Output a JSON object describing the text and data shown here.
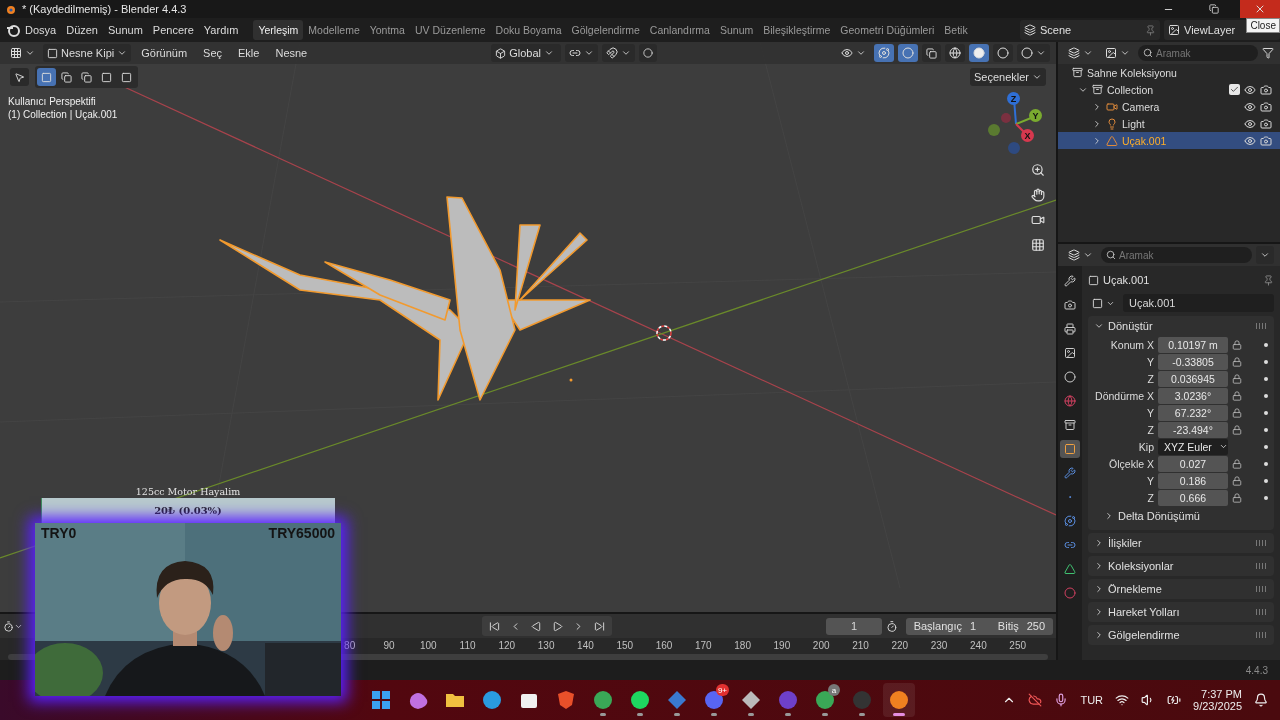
{
  "window": {
    "title": "* (Kaydedilmemiş) - Blender 4.4.3",
    "tooltip": "Close"
  },
  "menu": [
    "Dosya",
    "Düzen",
    "Sunum",
    "Pencere",
    "Yardım"
  ],
  "workspaces": [
    {
      "label": "Yerleşim",
      "selected": true
    },
    {
      "label": "Modelleme",
      "selected": false
    },
    {
      "label": "Yontma",
      "selected": false
    },
    {
      "label": "UV Düzenleme",
      "selected": false
    },
    {
      "label": "Doku Boyama",
      "selected": false
    },
    {
      "label": "Gölgelendirme",
      "selected": false
    },
    {
      "label": "Canlandırma",
      "selected": false
    },
    {
      "label": "Sunum",
      "selected": false
    },
    {
      "label": "Bileşikleştirme",
      "selected": false
    },
    {
      "label": "Geometri Düğümleri",
      "selected": false
    },
    {
      "label": "Betik",
      "selected": false
    }
  ],
  "scene": "Scene",
  "view_layer": "ViewLayer",
  "viewport": {
    "mode": "Nesne Kipi",
    "menus": [
      "Görünüm",
      "Seç",
      "Ekle",
      "Nesne"
    ],
    "orientation": "Global",
    "options": "Seçenekler",
    "info": [
      "Kullanıcı Perspektifi",
      "(1) Collection | Uçak.001"
    ],
    "gizmo_axes": [
      {
        "label": "Z",
        "color": "#2f6fd6"
      },
      {
        "label": "Y",
        "color": "#7aab2f"
      },
      {
        "label": "X",
        "color": "#d6384e"
      }
    ]
  },
  "outliner": {
    "placeholder": "Aramak",
    "root": "Sahne Koleksiyonu",
    "collection": {
      "name": "Collection",
      "expanded": true,
      "checked": true,
      "children": [
        {
          "name": "Camera",
          "kind": "camera",
          "selected": false
        },
        {
          "name": "Light",
          "kind": "light",
          "selected": false
        },
        {
          "name": "Uçak.001",
          "kind": "mesh",
          "selected": true
        }
      ]
    }
  },
  "properties": {
    "placeholder": "Aramak",
    "tabs": [
      {
        "kind": "tool",
        "selected": false
      },
      {
        "kind": "render",
        "selected": false
      },
      {
        "kind": "output",
        "selected": false
      },
      {
        "kind": "view",
        "selected": false
      },
      {
        "kind": "scene",
        "selected": false
      },
      {
        "kind": "world",
        "selected": false
      },
      {
        "kind": "collection",
        "selected": false
      },
      {
        "kind": "object",
        "selected": true
      },
      {
        "kind": "modifier",
        "selected": false
      },
      {
        "kind": "particles",
        "selected": false
      },
      {
        "kind": "physics",
        "selected": false
      },
      {
        "kind": "constraint",
        "selected": false
      },
      {
        "kind": "data",
        "selected": false
      },
      {
        "kind": "material",
        "selected": false
      }
    ],
    "object": "Uçak.001",
    "data_name": "Uçak.001",
    "section": "Dönüştür",
    "rows": [
      {
        "kind": "field",
        "label": "Konum X",
        "value": "0.10197 m"
      },
      {
        "kind": "field",
        "label": "Y",
        "value": "-0.33805"
      },
      {
        "kind": "field",
        "label": "Z",
        "value": "0.036945"
      },
      {
        "kind": "field",
        "label": "Döndürme X",
        "value": "3.0236°"
      },
      {
        "kind": "field",
        "label": "Y",
        "value": "67.232°"
      },
      {
        "kind": "field",
        "label": "Z",
        "value": "-23.494°"
      },
      {
        "kind": "dropdown",
        "label": "Kip",
        "value": "XYZ Euler"
      },
      {
        "kind": "field",
        "label": "Ölçekle X",
        "value": "0.027"
      },
      {
        "kind": "field",
        "label": "Y",
        "value": "0.186"
      },
      {
        "kind": "field",
        "label": "Z",
        "value": "0.666"
      }
    ],
    "subsection": "Delta Dönüşümü",
    "panels": [
      "İlişkiler",
      "Koleksiyonlar",
      "Örnekleme",
      "Hareket Yolları",
      "Gölgelendirme"
    ]
  },
  "timeline": {
    "frame": "1",
    "start_label": "Başlangıç",
    "start": "1",
    "end_label": "Bitiş",
    "end": "250",
    "ticks": [
      "80",
      "90",
      "100",
      "110",
      "120",
      "130",
      "140",
      "150",
      "160",
      "170",
      "180",
      "190",
      "200",
      "210",
      "220",
      "230",
      "240",
      "250"
    ]
  },
  "status": {
    "version": "4.4.3"
  },
  "stream_overlay": {
    "goal": "125cc Motor Hayalim",
    "amount": "20₺ (0.03%)",
    "level": 0.0003,
    "min": "TRY0",
    "max": "TRY65000"
  },
  "taskbar": {
    "apps": [
      {
        "kind": "start",
        "selected": false
      },
      {
        "kind": "copilot",
        "selected": false
      },
      {
        "kind": "folder",
        "selected": false
      },
      {
        "kind": "edge",
        "selected": false
      },
      {
        "kind": "store",
        "selected": false
      },
      {
        "kind": "brave",
        "selected": false
      },
      {
        "kind": "chrome",
        "selected": false
      },
      {
        "kind": "spotify",
        "selected": false
      },
      {
        "kind": "cube",
        "selected": false
      },
      {
        "kind": "discord",
        "selected": false,
        "badge": "9+"
      },
      {
        "kind": "unity",
        "selected": false
      },
      {
        "kind": "github",
        "selected": false
      },
      {
        "kind": "chrome",
        "selected": false,
        "badge": "a"
      },
      {
        "kind": "obs",
        "selected": false
      },
      {
        "kind": "blender",
        "selected": true
      }
    ],
    "language": "TUR",
    "time": "7:37 PM",
    "date": "9/23/2025"
  }
}
